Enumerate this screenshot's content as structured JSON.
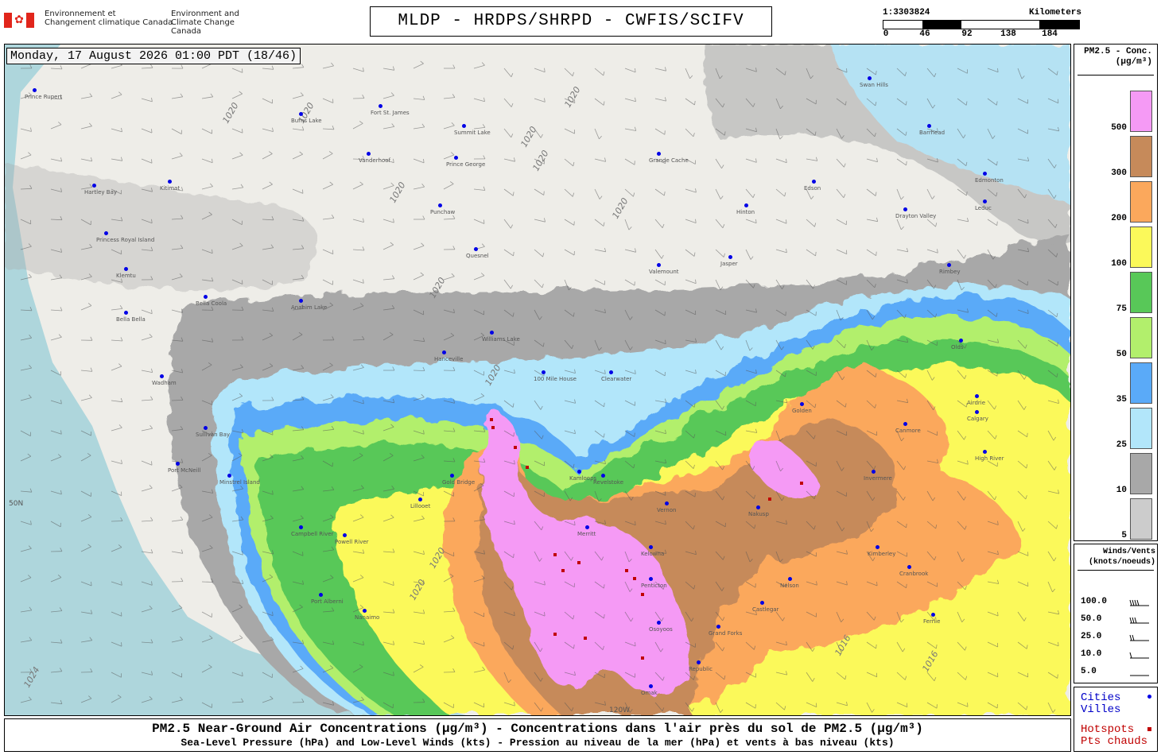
{
  "header": {
    "dept_fr": [
      "Environnement et",
      "Changement climatique Canada"
    ],
    "dept_en": [
      "Environment and",
      "Climate Change Canada"
    ],
    "title": "MLDP - HRDPS/SHRPD - CWFIS/SCIFV"
  },
  "scale": {
    "ratio": "1:3303824",
    "unit": "Kilometers",
    "ticks": [
      "0",
      "46",
      "92",
      "138",
      "184"
    ]
  },
  "timestamp": "Monday, 17 August 2026 01:00 PDT (18/46)",
  "legend": {
    "title": [
      "PM2.5 - Conc.",
      "(µg/m³)"
    ],
    "bins": [
      {
        "label": "500",
        "color": "#f59af5"
      },
      {
        "label": "300",
        "color": "#c68a5a"
      },
      {
        "label": "200",
        "color": "#fba85c"
      },
      {
        "label": "100",
        "color": "#fbf95a"
      },
      {
        "label": "75",
        "color": "#58c858"
      },
      {
        "label": "50",
        "color": "#b2ef6c"
      },
      {
        "label": "35",
        "color": "#5aaaf8"
      },
      {
        "label": "25",
        "color": "#b2e6fa"
      },
      {
        "label": "10",
        "color": "#a8a8a8"
      },
      {
        "label": "5",
        "color": "#cccccc"
      }
    ]
  },
  "winds": {
    "title": [
      "Winds/Vents",
      "(knots/noeuds)"
    ],
    "rows": [
      "100.0",
      "50.0",
      "25.0",
      "10.0",
      "5.0"
    ]
  },
  "markers": {
    "cities": [
      "Cities",
      "Villes"
    ],
    "hotspots": [
      "Hotspots",
      "Pts chauds"
    ]
  },
  "footer": {
    "line1": "PM2.5 Near-Ground Air Concentrations (µg/m³) - Concentrations dans l'air près du sol de PM2.5 (µg/m³)",
    "line2": "Sea-Level Pressure (hPa) and Low-Level Winds (kts) - Pression au niveau de la mer (hPa) et vents à bas niveau (kts)"
  },
  "map": {
    "isobar_labels": [
      "1020",
      "1020",
      "1020",
      "1020",
      "1020",
      "1020",
      "1020",
      "1020",
      "1020",
      "1020",
      "1020",
      "1016",
      "1016",
      "1024"
    ],
    "lat_label": "50N",
    "lon_label": "120W",
    "cities": [
      "Prince Rupert",
      "Fort St. James",
      "Burns Lake",
      "Summit Lake",
      "Grande Cache",
      "Vanderhoof",
      "Prince George",
      "Kitimat",
      "Punchaw",
      "Hinton",
      "Edson",
      "Edmonton",
      "Drayton Valley",
      "Leduc",
      "Hartley Bay",
      "Princess Royal Island",
      "Klemtu",
      "Quesnel",
      "Valemount",
      "Jasper",
      "Rimbey",
      "Bella Coola",
      "Bella Bella",
      "Anahim Lake",
      "Williams Lake",
      "Olds",
      "Hanceville",
      "100 Mile House",
      "Clearwater",
      "Airdrie",
      "Calgary",
      "Wadham",
      "Sullivan Bay",
      "Port McNeill",
      "Minstrel Island",
      "Gold Bridge",
      "Kamloops",
      "Revelstoke",
      "Golden",
      "Canmore",
      "High River",
      "Invermere",
      "Nakusp",
      "Vernon",
      "Merritt",
      "Kelowna",
      "Penticton",
      "Osoyoos",
      "Grand Forks",
      "Castlegar",
      "Nelson",
      "Cranbrook",
      "Kimberley",
      "Fernie",
      "Campbell River",
      "Powell River",
      "Port Alberni",
      "Nanaimo",
      "Lillooet",
      "Republic",
      "Omak",
      "Swan Hills",
      "Barrhead"
    ]
  }
}
